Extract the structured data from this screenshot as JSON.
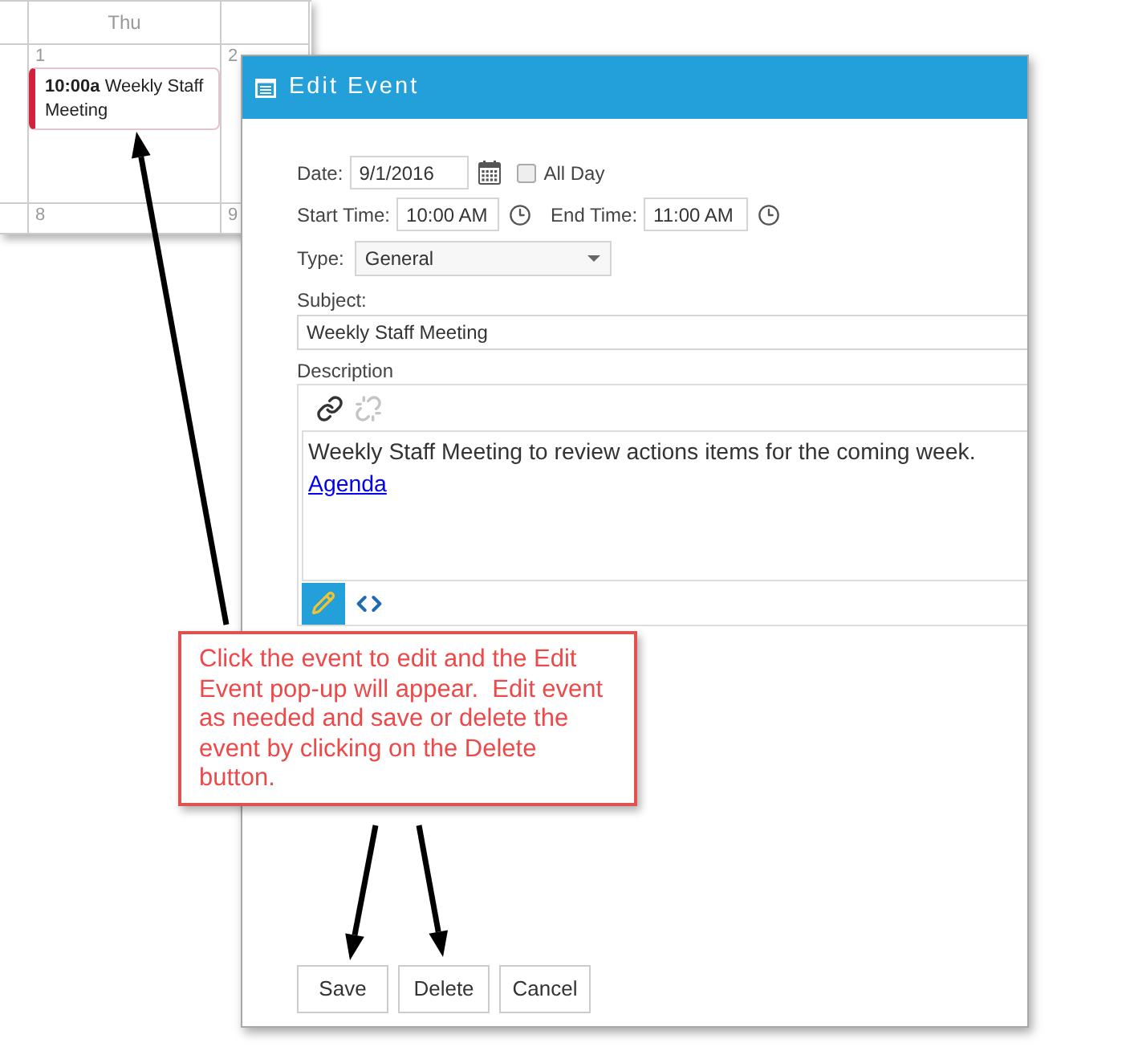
{
  "calendar": {
    "day_header": "Thu",
    "weeks": [
      {
        "days": [
          {
            "number": "1",
            "events": [
              {
                "text": "**10:00a** Weekly Staff Meeting"
              }
            ]
          },
          {
            "number": "2"
          }
        ]
      },
      {
        "days": [
          {
            "number": "8"
          },
          {
            "number": "9"
          }
        ]
      }
    ]
  },
  "dialog": {
    "title": "Edit Event",
    "date": {
      "label": "Date:",
      "value": "9/1/2016"
    },
    "all_day": {
      "label": "All Day",
      "checked": false
    },
    "start_time": {
      "label": "Start Time:",
      "value": "10:00 AM"
    },
    "end_time": {
      "label": "End Time:",
      "value": "11:00 AM"
    },
    "type": {
      "label": "Type:",
      "value": "General"
    },
    "subject": {
      "label": "Subject:",
      "value": "Weekly Staff Meeting"
    },
    "description": {
      "label": "Description",
      "toolbar": [
        {
          "kind": "link",
          "disabled": false
        },
        {
          "kind": "unlink",
          "disabled": true
        }
      ],
      "text": "Weekly Staff Meeting to review actions items for the coming week.",
      "link": "Agenda",
      "modes": [
        {
          "kind": "design",
          "selected": true
        },
        {
          "kind": "html",
          "selected": false
        }
      ]
    },
    "buttons": [
      "Save",
      "Delete",
      "Cancel"
    ]
  },
  "callout": {
    "text": "Click the event to edit and the Edit Event pop-up will appear.  Edit event as needed and save or delete the event by clicking on the Delete button."
  }
}
